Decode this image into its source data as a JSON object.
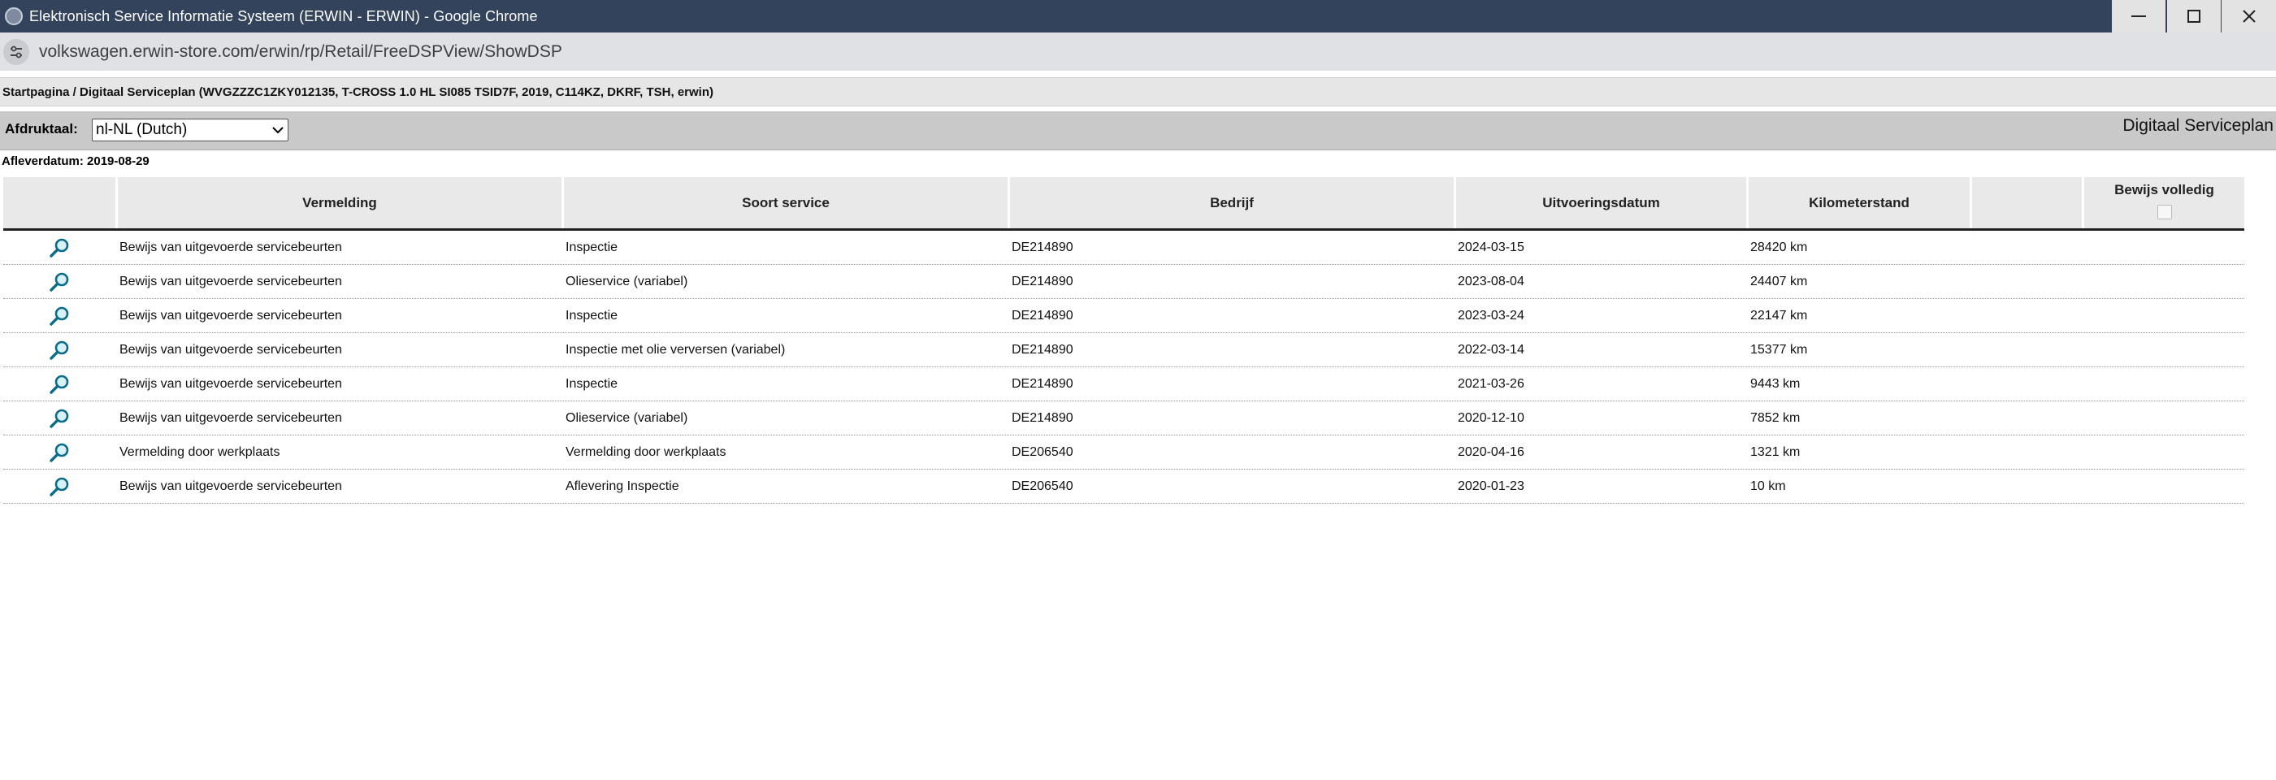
{
  "window": {
    "title": "Elektronisch Service Informatie Systeem (ERWIN - ERWIN) - Google Chrome"
  },
  "addressbar": {
    "url": "volkswagen.erwin-store.com/erwin/rp/Retail/FreeDSPView/ShowDSP"
  },
  "breadcrumb": {
    "text": "Startpagina / Digitaal Serviceplan (WVGZZZC1ZKY012135, T-CROSS 1.0 HL SI085 TSID7F, 2019, C114KZ, DKRF, TSH, erwin)"
  },
  "langbar": {
    "label": "Afdruktaal:",
    "selected": "nl-NL (Dutch)",
    "page_label": "Digitaal Serviceplan"
  },
  "delivery_date": "Afleverdatum: 2019-08-29",
  "table": {
    "headers": {
      "vermelding": "Vermelding",
      "soort": "Soort service",
      "bedrijf": "Bedrijf",
      "datum": "Uitvoeringsdatum",
      "km": "Kilometerstand",
      "bewijs": "Bewijs volledig"
    },
    "rows": [
      {
        "vermelding": "Bewijs van uitgevoerde servicebeurten",
        "soort": "Inspectie",
        "bedrijf": "DE214890",
        "datum": "2024-03-15",
        "km": "28420 km"
      },
      {
        "vermelding": "Bewijs van uitgevoerde servicebeurten",
        "soort": "Olieservice (variabel)",
        "bedrijf": "DE214890",
        "datum": "2023-08-04",
        "km": "24407 km"
      },
      {
        "vermelding": "Bewijs van uitgevoerde servicebeurten",
        "soort": "Inspectie",
        "bedrijf": "DE214890",
        "datum": "2023-03-24",
        "km": "22147 km"
      },
      {
        "vermelding": "Bewijs van uitgevoerde servicebeurten",
        "soort": "Inspectie met olie verversen (variabel)",
        "bedrijf": "DE214890",
        "datum": "2022-03-14",
        "km": "15377 km"
      },
      {
        "vermelding": "Bewijs van uitgevoerde servicebeurten",
        "soort": "Inspectie",
        "bedrijf": "DE214890",
        "datum": "2021-03-26",
        "km": "9443 km"
      },
      {
        "vermelding": "Bewijs van uitgevoerde servicebeurten",
        "soort": "Olieservice (variabel)",
        "bedrijf": "DE214890",
        "datum": "2020-12-10",
        "km": "7852 km"
      },
      {
        "vermelding": "Vermelding door werkplaats",
        "soort": "Vermelding door werkplaats",
        "bedrijf": "DE206540",
        "datum": "2020-04-16",
        "km": "1321 km"
      },
      {
        "vermelding": "Bewijs van uitgevoerde servicebeurten",
        "soort": "Aflevering Inspectie",
        "bedrijf": "DE206540",
        "datum": "2020-01-23",
        "km": "10 km"
      }
    ]
  },
  "icons": {
    "row_action": "magnifier-icon",
    "site_info": "tune-icon",
    "select_arrow": "chevron-down-icon"
  },
  "colors": {
    "titlebar": "#34435c",
    "addressbar": "#dfe1e5",
    "langbar": "#c9c9c9",
    "header_cell": "#e9e9e9",
    "magnifier": "#0b6c8a"
  }
}
